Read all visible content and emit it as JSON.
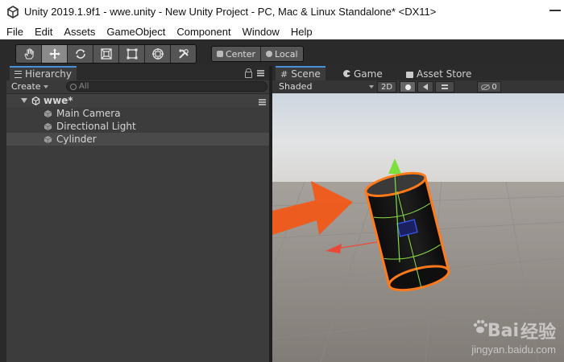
{
  "window": {
    "title": "Unity 2019.1.9f1 - wwe.unity - New Unity Project - PC, Mac & Linux Standalone* <DX11>"
  },
  "menu": {
    "items": [
      "File",
      "Edit",
      "Assets",
      "GameObject",
      "Component",
      "Window",
      "Help"
    ]
  },
  "toolbar": {
    "tools": [
      "hand-icon",
      "move-icon",
      "rotate-icon",
      "scale-icon",
      "rect-icon",
      "transform-icon",
      "custom-tool-icon"
    ],
    "active_tool": "move-icon",
    "pivot_label": "Center",
    "space_label": "Local"
  },
  "hierarchy": {
    "tab_label": "Hierarchy",
    "create_label": "Create",
    "search_placeholder": "All",
    "scene_name": "wwe*",
    "objects": [
      "Main Camera",
      "Directional Light",
      "Cylinder"
    ],
    "selected": "Cylinder"
  },
  "scene_view": {
    "tabs": [
      "Scene",
      "Game",
      "Asset Store"
    ],
    "active_tab": "Scene",
    "shading_mode": "Shaded",
    "mode_2d_label": "2D",
    "gizmo_count": "0"
  },
  "watermark": {
    "brand_left": "Bai",
    "brand_right": "经验",
    "url": "jingyan.baidu.com"
  },
  "colors": {
    "accent_tab": "#4a90d9",
    "arrow_orange": "#f05a1a",
    "selection_outline": "#ff7a1a",
    "gizmo_green": "#7ee03a",
    "gizmo_red": "#e84a3a"
  }
}
